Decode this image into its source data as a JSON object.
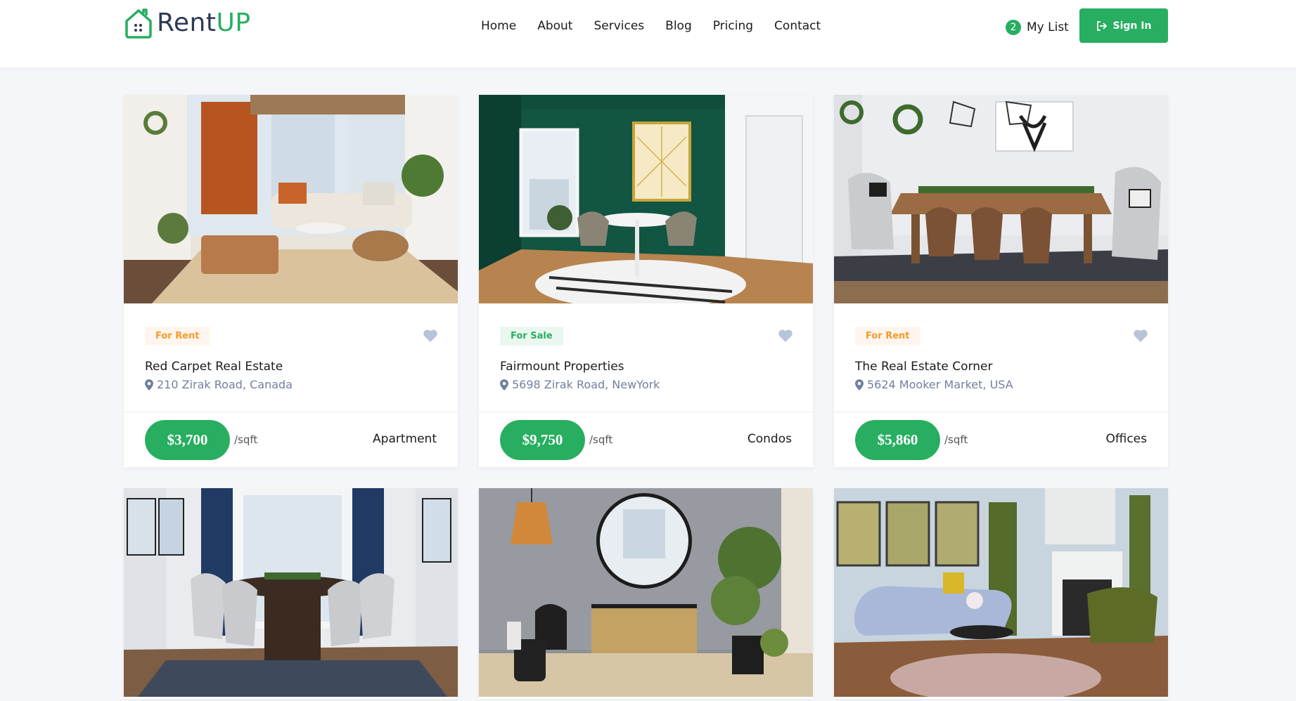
{
  "brand": {
    "name_part1": "Rent",
    "name_part2": "UP",
    "primary_color": "#27ae60",
    "dark_color": "#2d3954"
  },
  "nav": {
    "items": [
      "Home",
      "About",
      "Services",
      "Blog",
      "Pricing",
      "Contact"
    ]
  },
  "header": {
    "mylist_count": "2",
    "mylist_label": "My List",
    "signin_label": "Sign In"
  },
  "listings": [
    {
      "tag": "For Rent",
      "title": "Red Carpet Real Estate",
      "address": "210 Zirak Road, Canada",
      "price": "$3,700",
      "unit": "/sqft",
      "category": "Apartment",
      "photo": "living-room-photo"
    },
    {
      "tag": "For Sale",
      "title": "Fairmount Properties",
      "address": "5698 Zirak Road, NewYork",
      "price": "$9,750",
      "unit": "/sqft",
      "category": "Condos",
      "photo": "dining-nook-photo"
    },
    {
      "tag": "For Rent",
      "title": "The Real Estate Corner",
      "address": "5624 Mooker Market, USA",
      "price": "$5,860",
      "unit": "/sqft",
      "category": "Offices",
      "photo": "dining-room-photo"
    }
  ],
  "listings_row2": [
    {
      "photo": "round-dining-photo"
    },
    {
      "photo": "entryway-photo"
    },
    {
      "photo": "lounge-photo"
    }
  ],
  "colors": {
    "rent_badge": "#f7992b",
    "sale_badge": "#27ae60",
    "heart": "#b9c3d8",
    "address": "#72809d"
  }
}
